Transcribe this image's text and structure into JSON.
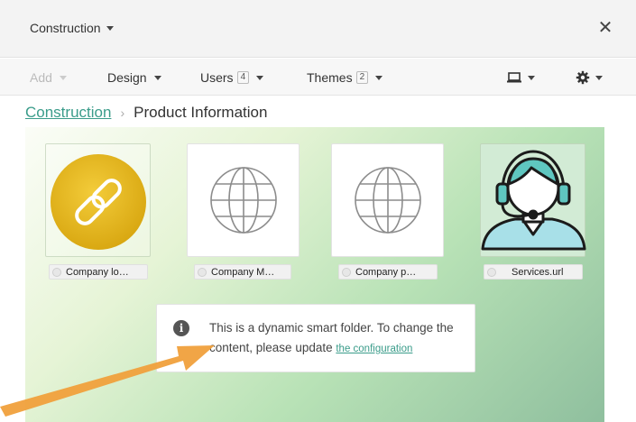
{
  "header": {
    "workspace_label": "Construction",
    "close_symbol": "✕"
  },
  "toolbar": {
    "add_label": "Add",
    "design_label": "Design",
    "users_label": "Users",
    "users_count": "4",
    "themes_label": "Themes",
    "themes_count": "2",
    "device_icon": "laptop-icon",
    "settings_icon": "gear-icon"
  },
  "breadcrumb": {
    "parent": "Construction",
    "current": "Product Information"
  },
  "tiles": [
    {
      "label": "Company lo…",
      "icon": "link-icon"
    },
    {
      "label": "Company M…",
      "icon": "globe-icon"
    },
    {
      "label": "Company p…",
      "icon": "globe-icon"
    },
    {
      "label": "Services.url",
      "icon": "support-agent-icon"
    }
  ],
  "notice": {
    "text": "This is a dynamic smart folder. To change the content, please update ",
    "link": "the configuration",
    "icon": "info-icon"
  },
  "colors": {
    "accent": "#3a9c8a",
    "link_tile": "#e8b820",
    "annotation_arrow": "#f0a03c"
  }
}
